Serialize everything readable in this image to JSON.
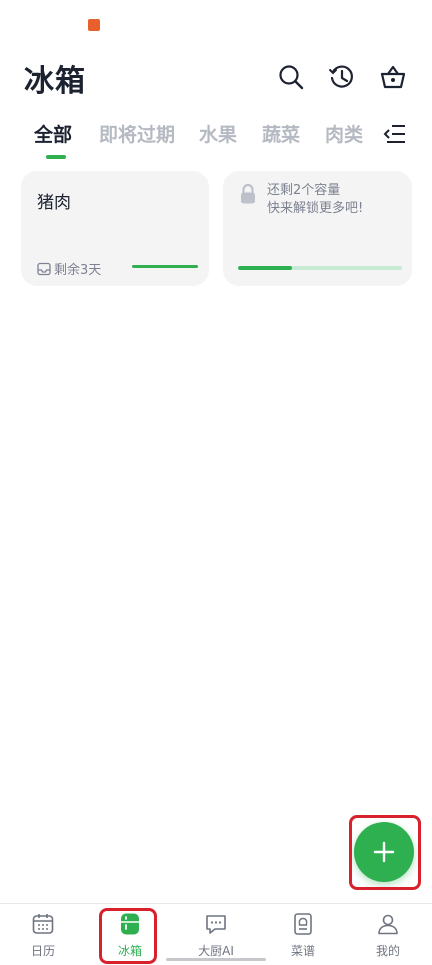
{
  "header": {
    "title": "冰箱"
  },
  "tabs": [
    {
      "label": "全部",
      "active": true
    },
    {
      "label": "即将过期"
    },
    {
      "label": "水果"
    },
    {
      "label": "蔬菜"
    },
    {
      "label": "肉类"
    }
  ],
  "cards": [
    {
      "name": "猪肉",
      "remaining": "剩余3天",
      "freshness_fraction": 1.0
    },
    {
      "lock_line1": "还剩2个容量",
      "lock_line2": "快来解锁更多吧!",
      "capacity_fraction": 0.33
    }
  ],
  "nav": [
    {
      "label": "日历",
      "icon": "calendar-icon"
    },
    {
      "label": "冰箱",
      "icon": "fridge-icon",
      "active": true
    },
    {
      "label": "大厨AI",
      "icon": "chat-icon"
    },
    {
      "label": "菜谱",
      "icon": "recipe-icon"
    },
    {
      "label": "我的",
      "icon": "profile-icon"
    }
  ],
  "colors": {
    "accent": "#2fb050",
    "annotation": "#d7222d",
    "inactive_tab": "#b5b9c2"
  }
}
